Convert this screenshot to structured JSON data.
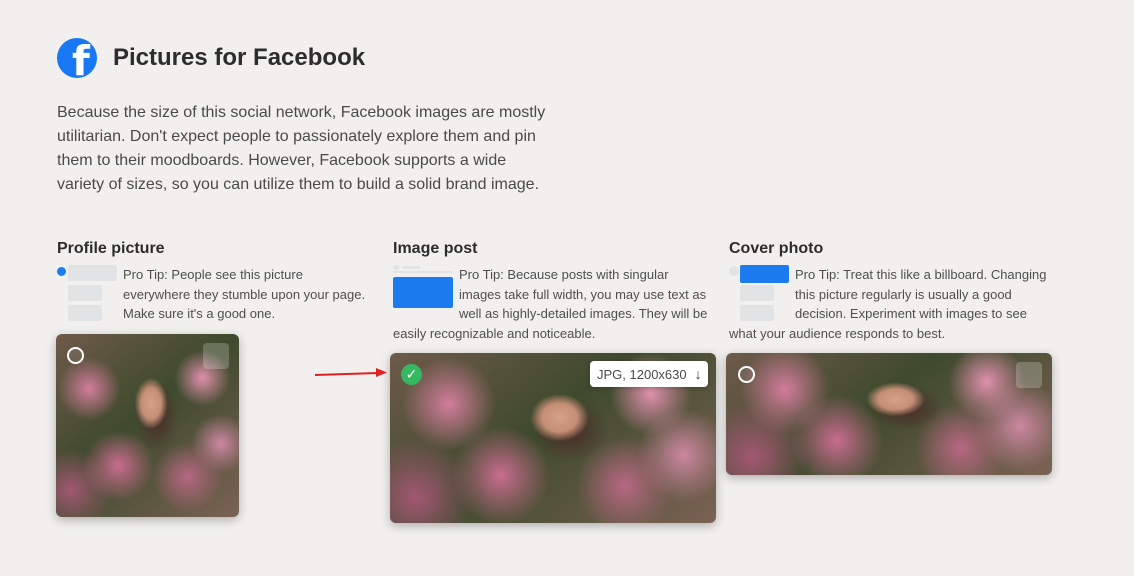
{
  "header": {
    "title": "Pictures for Facebook",
    "logo_icon": "facebook-icon",
    "logo_glyph": "f",
    "brand_color": "#1877f2"
  },
  "intro": "Because the size of this social network, Facebook images are mostly utilitarian. Don't expect people to passionately explore them and pin them to their moodboards. However, Facebook supports a wide variety of sizes, so you can utilize them to build a solid brand image.",
  "sections": [
    {
      "title": "Profile picture",
      "tip": "Pro Tip: People see this picture everywhere they stumble upon your page. Make sure it's a good one.",
      "selected": false
    },
    {
      "title": "Image post",
      "tip": "Pro Tip: Because posts with singular images take full width, you may use text as well as highly-detailed images. They will be easily recognizable and noticeable.",
      "selected": true,
      "format_label": "JPG, 1200x630",
      "download_icon": "download-arrow-icon",
      "download_glyph": "↓"
    },
    {
      "title": "Cover photo",
      "tip": "Pro Tip: Treat this like a billboard. Changing this picture regularly is usually a good decision. Experiment with images to see what your audience responds to best.",
      "selected": false
    }
  ],
  "check_glyph": "✓",
  "colors": {
    "accent": "#1d7bf0",
    "selected_check": "#36b860",
    "annotation_arrow": "#e02020",
    "background": "#f1f0ee"
  }
}
